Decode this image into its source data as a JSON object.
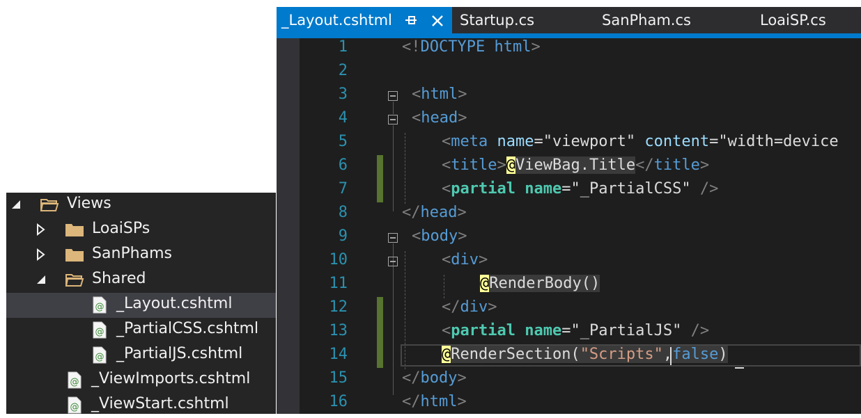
{
  "tabs": [
    {
      "label": "_Layout.cshtml",
      "active": true
    },
    {
      "label": "Startup.cs",
      "active": false
    },
    {
      "label": "SanPham.cs",
      "active": false
    },
    {
      "label": "LoaiSP.cs",
      "active": false
    }
  ],
  "tab_icons": {
    "pin": "pin-icon",
    "close": "close-icon"
  },
  "colors": {
    "accent": "#007acc",
    "editor_bg": "#1e1e1e",
    "change_marker": "#577430",
    "line_number": "#2b91af"
  },
  "line_numbers": [
    "1",
    "2",
    "3",
    "4",
    "5",
    "6",
    "7",
    "8",
    "9",
    "10",
    "11",
    "12",
    "13",
    "14",
    "15",
    "16"
  ],
  "code": {
    "l1": {
      "a": "<!",
      "b": "DOCTYPE",
      "c": " ",
      "d": "html",
      "e": ">"
    },
    "l3": {
      "a": "<",
      "b": "html",
      "c": ">"
    },
    "l4": {
      "a": "<",
      "b": "head",
      "c": ">"
    },
    "l5": {
      "a": "<",
      "b": "meta",
      "c": " ",
      "d": "name",
      "e": "=",
      "f": "\"viewport\"",
      "g": " ",
      "h": "content",
      "i": "=",
      "j": "\"width=device"
    },
    "l6": {
      "a": "<",
      "b": "title",
      "c": ">",
      "d": "@",
      "e": "ViewBag.Title",
      "f": "</",
      "g": "title",
      "h": ">"
    },
    "l7": {
      "a": "<",
      "b": "partial",
      "c": " ",
      "d": "name",
      "e": "=",
      "f": "\"_PartialCSS\"",
      "g": " ",
      "h": "/>"
    },
    "l8": {
      "a": "</",
      "b": "head",
      "c": ">"
    },
    "l9": {
      "a": "<",
      "b": "body",
      "c": ">"
    },
    "l10": {
      "a": "<",
      "b": "div",
      "c": ">"
    },
    "l11": {
      "a": "@",
      "b": "RenderBody()"
    },
    "l12": {
      "a": "</",
      "b": "div",
      "c": ">"
    },
    "l13": {
      "a": "<",
      "b": "partial",
      "c": " ",
      "d": "name",
      "e": "=",
      "f": "\"_PartialJS\"",
      "g": " ",
      "h": "/>"
    },
    "l14": {
      "a": "@",
      "b": "RenderSection(",
      "c": "\"Scripts\"",
      "d": ",",
      "e": "false",
      "f": ")"
    },
    "l15": {
      "a": "</",
      "b": "body",
      "c": ">"
    },
    "l16": {
      "a": "</",
      "b": "html",
      "c": ">"
    }
  },
  "explorer": [
    {
      "label": "Views",
      "icon": "folder-open-icon",
      "arrow": "expanded-arrow-icon"
    },
    {
      "label": "LoaiSPs",
      "icon": "folder-icon",
      "arrow": "collapsed-arrow-icon"
    },
    {
      "label": "SanPhams",
      "icon": "folder-icon",
      "arrow": "collapsed-arrow-icon"
    },
    {
      "label": "Shared",
      "icon": "folder-open-icon",
      "arrow": "expanded-arrow-icon"
    },
    {
      "label": "_Layout.cshtml",
      "icon": "razor-file-icon",
      "selected": true
    },
    {
      "label": "_PartialCSS.cshtml",
      "icon": "razor-file-icon"
    },
    {
      "label": "_PartialJS.cshtml",
      "icon": "razor-file-icon"
    },
    {
      "label": "_ViewImports.cshtml",
      "icon": "razor-file-icon"
    },
    {
      "label": "_ViewStart.cshtml",
      "icon": "razor-file-icon"
    }
  ]
}
